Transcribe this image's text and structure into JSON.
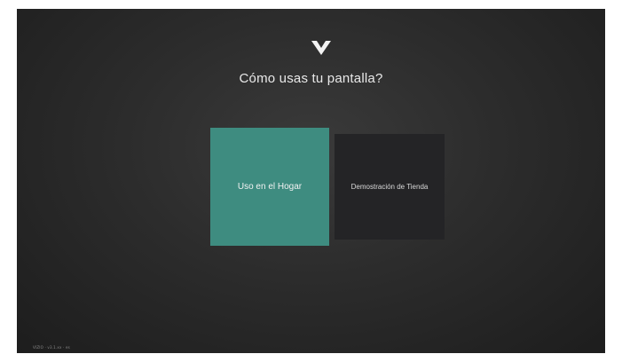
{
  "screen": {
    "logo_icon": "vizio-v-icon",
    "title": "Cómo usas tu pantalla?",
    "options": [
      {
        "label": "Uso en el Hogar",
        "selected": true,
        "color": "#3e8c80"
      },
      {
        "label": "Demostración de Tienda",
        "selected": false,
        "color": "#242426"
      }
    ],
    "footer": "VIZIO · v3.1.xx · es"
  }
}
